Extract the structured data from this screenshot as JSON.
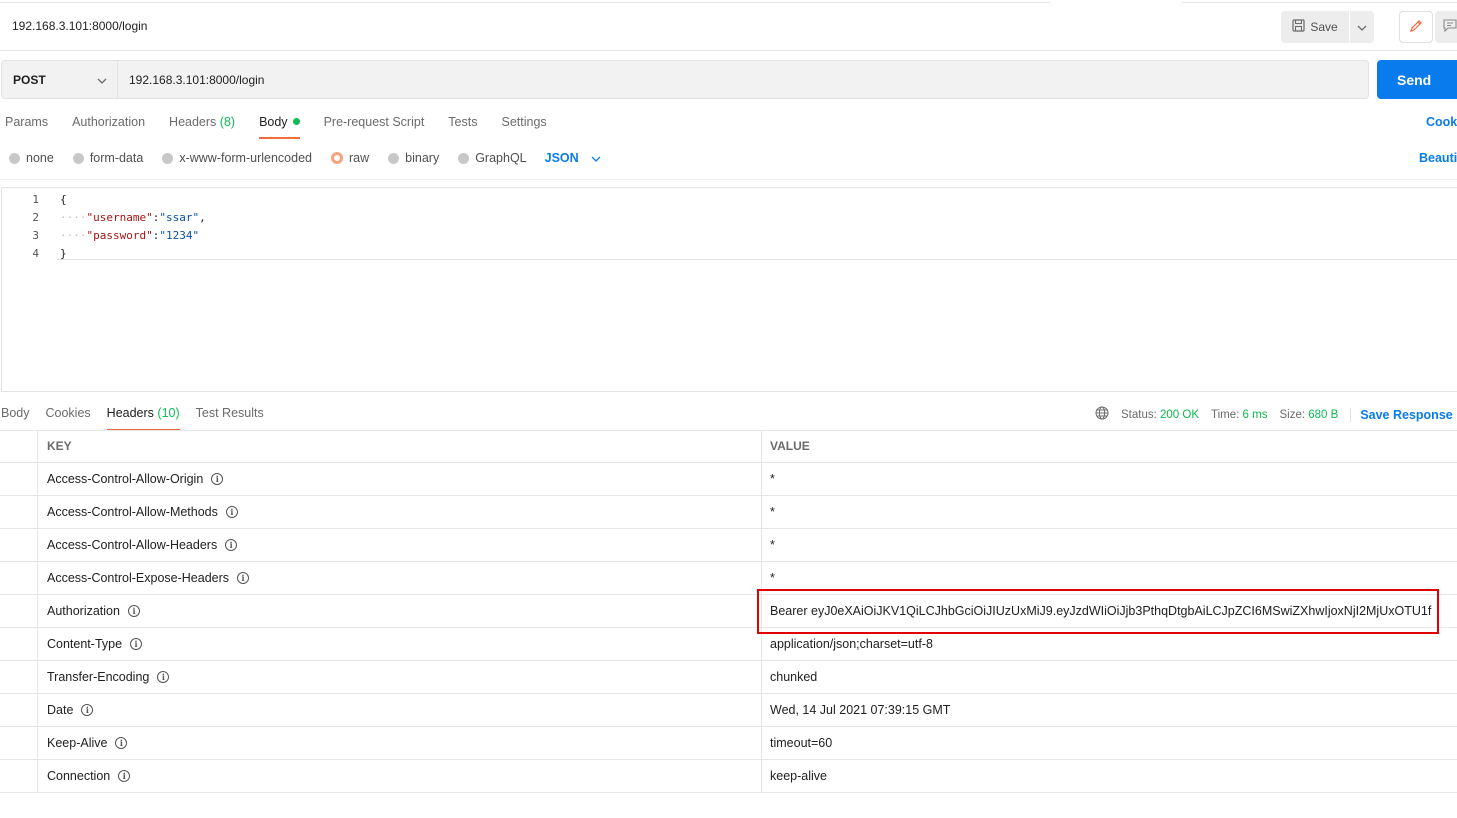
{
  "header": {
    "title": "192.168.3.101:8000/login",
    "save_label": "Save"
  },
  "request": {
    "method": "POST",
    "url": "192.168.3.101:8000/login",
    "send_label": "Send"
  },
  "request_tabs": {
    "params": "Params",
    "authorization": "Authorization",
    "headers": "Headers",
    "headers_count": "(8)",
    "body": "Body",
    "pre_request": "Pre-request Script",
    "tests": "Tests",
    "settings": "Settings",
    "cookies": "Cook"
  },
  "body_types": {
    "none": "none",
    "form_data": "form-data",
    "urlencoded": "x-www-form-urlencoded",
    "raw": "raw",
    "binary": "binary",
    "graphql": "GraphQL",
    "format": "JSON",
    "selected": "raw",
    "beautify": "Beautif"
  },
  "editor": {
    "lines": [
      {
        "n": "1",
        "text": "{"
      },
      {
        "n": "2",
        "key": "\"username\"",
        "value": "\"ssar\"",
        "tail": ","
      },
      {
        "n": "3",
        "key": "\"password\"",
        "value": "\"1234\"",
        "tail": ""
      },
      {
        "n": "4",
        "text": "}"
      }
    ]
  },
  "response_tabs": {
    "body": "Body",
    "cookies": "Cookies",
    "headers": "Headers",
    "headers_count": "(10)",
    "test_results": "Test Results"
  },
  "response_status": {
    "status_label": "Status:",
    "status_value": "200 OK",
    "time_label": "Time:",
    "time_value": "6 ms",
    "size_label": "Size:",
    "size_value": "680 B",
    "save_response": "Save Response"
  },
  "headers_table": {
    "key_header": "KEY",
    "value_header": "VALUE",
    "rows": [
      {
        "key": "Access-Control-Allow-Origin",
        "value": "*"
      },
      {
        "key": "Access-Control-Allow-Methods",
        "value": "*"
      },
      {
        "key": "Access-Control-Allow-Headers",
        "value": "*"
      },
      {
        "key": "Access-Control-Expose-Headers",
        "value": "*"
      },
      {
        "key": "Authorization",
        "value": "Bearer eyJ0eXAiOiJKV1QiLCJhbGciOiJIUzUxMiJ9.eyJzdWIiOiJjb3PthqDtgbAiLCJpZCI6MSwiZXhwIjoxNjI2MjUxOTU1f"
      },
      {
        "key": "Content-Type",
        "value": "application/json;charset=utf-8"
      },
      {
        "key": "Transfer-Encoding",
        "value": "chunked"
      },
      {
        "key": "Date",
        "value": "Wed, 14 Jul 2021 07:39:15 GMT"
      },
      {
        "key": "Keep-Alive",
        "value": "timeout=60"
      },
      {
        "key": "Connection",
        "value": "keep-alive"
      }
    ]
  },
  "colors": {
    "accent": "#097bed",
    "active_tab": "#f26b3a",
    "status_green": "#0cbb52",
    "highlight": "#e10000"
  }
}
